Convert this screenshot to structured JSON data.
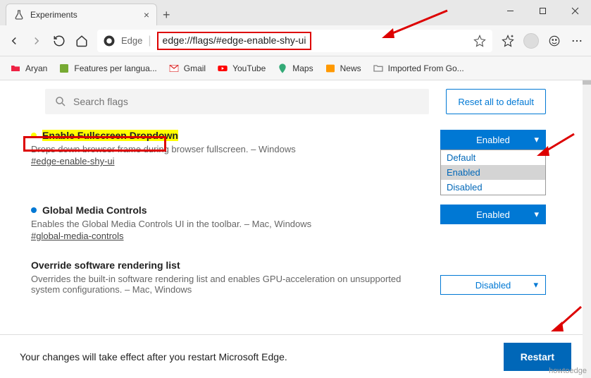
{
  "window": {
    "tab_title": "Experiments"
  },
  "toolbar": {
    "addr_label": "Edge",
    "url": "edge://flags/#edge-enable-shy-ui"
  },
  "bookmarks": [
    {
      "label": "Aryan",
      "color": "#e24"
    },
    {
      "label": "Features per langua...",
      "color": "#7a3"
    },
    {
      "label": "Gmail",
      "color": "#d33"
    },
    {
      "label": "YouTube",
      "color": "#f00"
    },
    {
      "label": "Maps",
      "color": "#3a7"
    },
    {
      "label": "News",
      "color": "#f90"
    },
    {
      "label": "Imported From Go...",
      "color": "#888"
    }
  ],
  "search": {
    "placeholder": "Search flags"
  },
  "reset_label": "Reset all to default",
  "flags": [
    {
      "title": "Enable Fullscreen Dropdown",
      "desc": "Drops down browser frame during browser fullscreen. – Windows",
      "hash": "#edge-enable-shy-ui",
      "value": "Enabled",
      "dot": true,
      "highlighted": true
    },
    {
      "title": "Global Media Controls",
      "desc": "Enables the Global Media Controls UI in the toolbar. – Mac, Windows",
      "hash": "#global-media-controls",
      "value": "Enabled",
      "dot": true,
      "highlighted": false
    },
    {
      "title": "Override software rendering list",
      "desc": "Overrides the built-in software rendering list and enables GPU-acceleration on unsupported system configurations. – Mac, Windows",
      "hash": "",
      "value": "Disabled",
      "dot": false,
      "highlighted": false
    }
  ],
  "dropdown_options": [
    "Default",
    "Enabled",
    "Disabled"
  ],
  "dropdown_selected": "Enabled",
  "restart": {
    "message": "Your changes will take effect after you restart Microsoft Edge.",
    "button": "Restart"
  },
  "watermark": "howtoedge"
}
